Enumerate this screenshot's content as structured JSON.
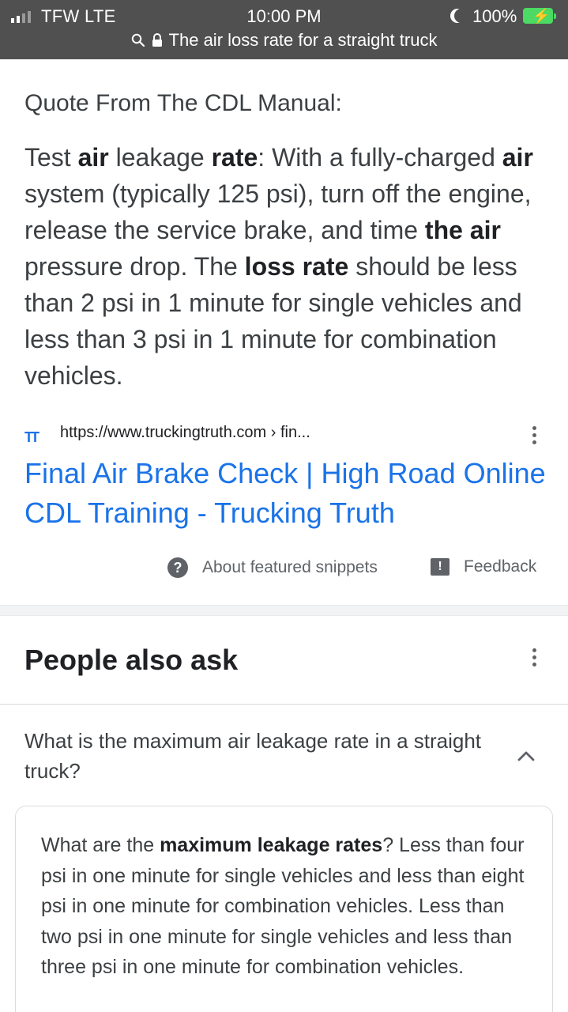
{
  "status_bar": {
    "carrier": "TFW  LTE",
    "time": "10:00 PM",
    "battery": "100%",
    "url_text": "The air loss rate for a straight truck"
  },
  "snippet": {
    "heading": "Quote From The CDL Manual:",
    "body": [
      {
        "t": "Test ",
        "b": false
      },
      {
        "t": "air",
        "b": true
      },
      {
        "t": " leakage ",
        "b": false
      },
      {
        "t": "rate",
        "b": true
      },
      {
        "t": ": With a fully-charged ",
        "b": false
      },
      {
        "t": "air",
        "b": true
      },
      {
        "t": " system (typically 125 psi), turn off the engine, release the service brake, and time ",
        "b": false
      },
      {
        "t": "the air",
        "b": true
      },
      {
        "t": " pressure drop. The ",
        "b": false
      },
      {
        "t": "loss rate",
        "b": true
      },
      {
        "t": " should be less than 2 psi in 1 minute for single vehicles and less than 3 psi in 1 minute for combination vehicles.",
        "b": false
      }
    ],
    "source_logo": "TT",
    "source_url": "https://www.truckingtruth.com › fin...",
    "link_title": "Final Air Brake Check | High Road Online CDL Training - Trucking Truth",
    "about_label": "About featured snippets",
    "feedback_label": "Feedback"
  },
  "people_also_ask": {
    "title": "People also ask",
    "question": "What is the maximum air leakage rate in a straight truck?",
    "answer": [
      {
        "t": "What are the ",
        "b": false
      },
      {
        "t": "maximum leakage rates",
        "b": true
      },
      {
        "t": "? Less than four psi in one minute for single vehicles and less than eight psi in one minute for combination vehicles. Less than two psi in one minute for single vehicles and less than three psi in one minute for combination vehicles.",
        "b": false
      }
    ]
  },
  "colors": {
    "status_bar_bg": "#505050",
    "link": "#1a73e8",
    "battery": "#4cd964"
  },
  "icons": [
    "signal-icon",
    "moon-icon",
    "battery-icon",
    "search-icon",
    "lock-icon",
    "trucking-truth-logo-icon",
    "more-vert-icon",
    "help-icon",
    "feedback-icon",
    "chevron-up-icon"
  ]
}
